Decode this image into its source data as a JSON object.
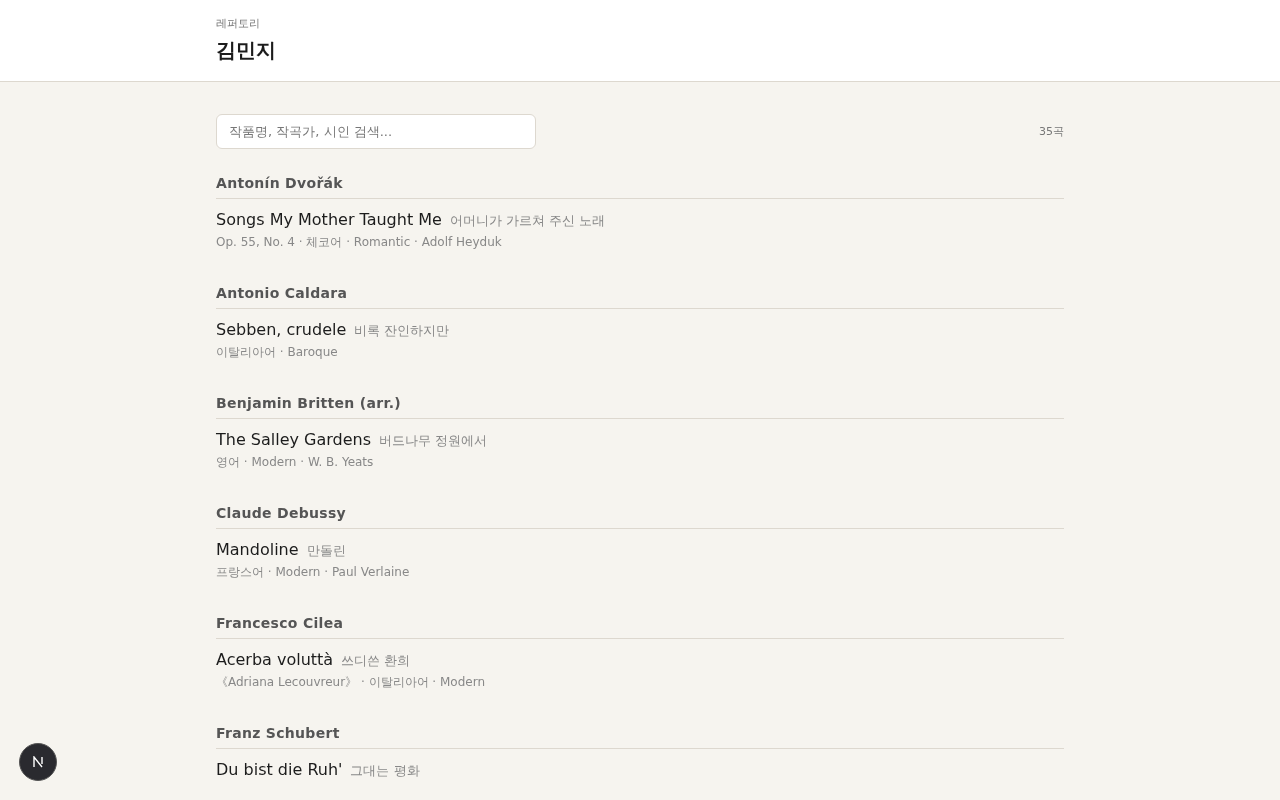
{
  "header": {
    "eyebrow": "레퍼토리",
    "title": "김민지"
  },
  "search": {
    "placeholder": "작품명, 작곡가, 시인 검색..."
  },
  "count": "35곡",
  "groups": [
    {
      "composer": "Antonín Dvořák",
      "songs": [
        {
          "title": "Songs My Mother Taught Me",
          "translation": "어머니가 가르쳐 주신 노래",
          "meta": "Op. 55, No. 4 · 체코어 · Romantic · Adolf Heyduk"
        }
      ]
    },
    {
      "composer": "Antonio Caldara",
      "songs": [
        {
          "title": "Sebben, crudele",
          "translation": "비록 잔인하지만",
          "meta": "이탈리아어 · Baroque"
        }
      ]
    },
    {
      "composer": "Benjamin Britten (arr.)",
      "songs": [
        {
          "title": "The Salley Gardens",
          "translation": "버드나무 정원에서",
          "meta": "영어 · Modern · W. B. Yeats"
        }
      ]
    },
    {
      "composer": "Claude Debussy",
      "songs": [
        {
          "title": "Mandoline",
          "translation": "만돌린",
          "meta": "프랑스어 · Modern · Paul Verlaine"
        }
      ]
    },
    {
      "composer": "Francesco Cilea",
      "songs": [
        {
          "title": "Acerba voluttà",
          "translation": "쓰디쓴 환희",
          "meta": "《Adriana Lecouvreur》 · 이탈리아어 · Modern"
        }
      ]
    },
    {
      "composer": "Franz Schubert",
      "songs": [
        {
          "title": "Du bist die Ruh'",
          "translation": "그대는 평화"
        }
      ]
    }
  ]
}
